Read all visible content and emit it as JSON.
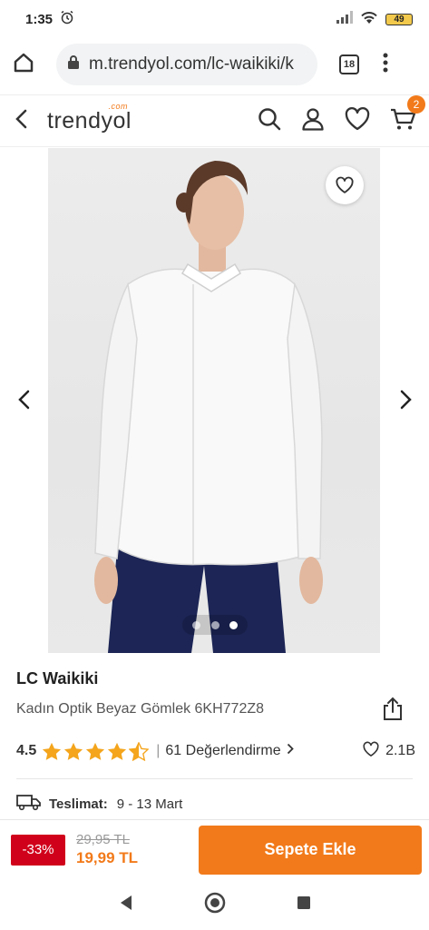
{
  "status_bar": {
    "time": "1:35",
    "battery": "49"
  },
  "browser": {
    "url": "m.trendyol.com/lc-waikiki/k",
    "tab_count": "18"
  },
  "app_header": {
    "logo": "trendyol",
    "logo_suffix": ".com",
    "cart_count": "2"
  },
  "gallery": {
    "slide_count": 3,
    "active_slide": 3
  },
  "product": {
    "brand": "LC Waikiki",
    "name": "Kadın Optik Beyaz Gömlek 6KH772Z8",
    "rating": "4.5",
    "rating_value": 4.5,
    "review_count": "61 Değerlendirme",
    "likes": "2.1B",
    "delivery_label": "Teslimat:",
    "delivery_dates": "9 - 13 Mart"
  },
  "purchase": {
    "discount": "-33%",
    "old_price": "29,95 TL",
    "new_price": "19,99 TL",
    "add_to_cart": "Sepete Ekle"
  },
  "colors": {
    "brand_orange": "#f27a1a",
    "discount_red": "#d0021b",
    "star": "#f4a51c"
  }
}
